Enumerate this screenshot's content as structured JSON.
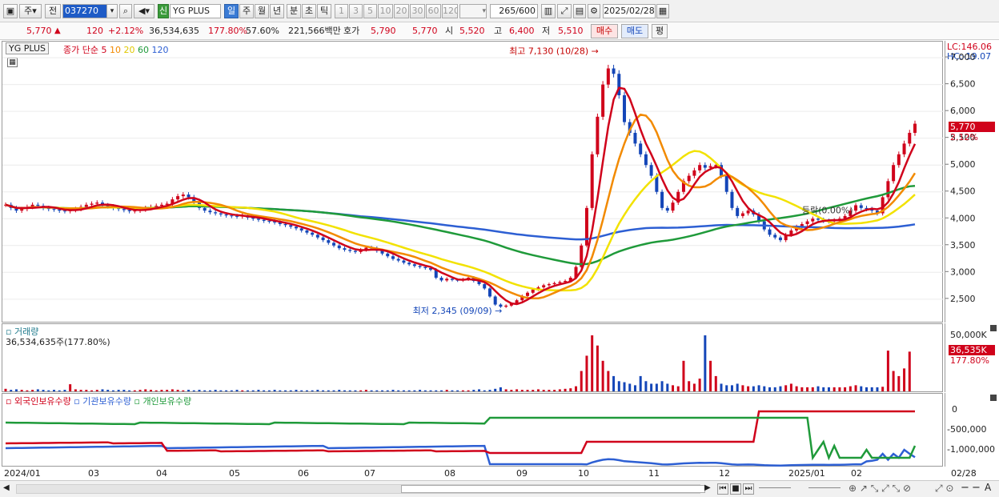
{
  "toolbar": {
    "period_type": "주",
    "prev_label": "전",
    "code": "037270",
    "name_tag": "신",
    "stock_name": "YG PLUS",
    "periods": [
      "일",
      "주",
      "월",
      "년",
      "분",
      "초",
      "틱"
    ],
    "selected_period": "일",
    "intervals": [
      "1",
      "3",
      "5",
      "10",
      "20",
      "30",
      "60",
      "120"
    ],
    "count": "265",
    "count_total": "/600",
    "date": "2025/02/28"
  },
  "quote": {
    "price": "5,770",
    "up_arrow": "▲",
    "change": "120",
    "change_pct": "+2.12%",
    "volume": "36,534,635",
    "volume_ratio": "177.80%",
    "turnover": "57.60%",
    "amount": "221,566백만",
    "ask_label": "호가",
    "ask": "5,790",
    "bid": "5,770",
    "open_label": "시",
    "open": "5,520",
    "high_label": "고",
    "high": "6,400",
    "low_label": "저",
    "low": "5,510",
    "buy_button": "매수",
    "sell_button": "매도",
    "eval_button": "평"
  },
  "chart_data": {
    "type": "candlestick",
    "stock": "YG PLUS",
    "close_label": "종가",
    "ma_label": "단순",
    "ma_periods": [
      "5",
      "10",
      "20",
      "60",
      "120"
    ],
    "ma_colors": [
      "#d0021b",
      "#f28a00",
      "#f2e200",
      "#1f9a3a",
      "#2d5fd3"
    ],
    "price_axis_ticks": [
      2500,
      3000,
      3500,
      4000,
      4500,
      5000,
      5500,
      6000,
      6500,
      7000
    ],
    "price_axis_labels": [
      "2,500",
      "3,000",
      "3,500",
      "4,000",
      "4,500",
      "5,000",
      "5,500",
      "6,000",
      "6,500",
      "7,000"
    ],
    "y_range": [
      2050,
      7300
    ],
    "lc": "LC:146.06",
    "hc": "HC:-19.07",
    "current_price": "5,770",
    "current_pct": "2.12%",
    "high_annotation": "최고 7,130 (10/28)",
    "low_annotation": "최저 2,345 (09/09)",
    "mid_annotation": "등락(0.00%)",
    "x_axis_labels": [
      "2024/01",
      "03",
      "04",
      "05",
      "06",
      "07",
      "08",
      "09",
      "10",
      "11",
      "12",
      "2025/01",
      "02",
      "02/28"
    ],
    "close_series": [
      4260,
      4200,
      4150,
      4180,
      4220,
      4260,
      4240,
      4200,
      4180,
      4170,
      4150,
      4140,
      4160,
      4180,
      4220,
      4260,
      4280,
      4300,
      4250,
      4230,
      4200,
      4180,
      4160,
      4140,
      4150,
      4170,
      4200,
      4220,
      4240,
      4260,
      4280,
      4360,
      4420,
      4450,
      4400,
      4300,
      4200,
      4150,
      4120,
      4100,
      4080,
      4060,
      4050,
      4040,
      4060,
      4020,
      4000,
      3980,
      3960,
      3950,
      3930,
      3900,
      3880,
      3850,
      3820,
      3780,
      3740,
      3700,
      3650,
      3600,
      3550,
      3500,
      3450,
      3420,
      3400,
      3380,
      3420,
      3460,
      3450,
      3400,
      3350,
      3300,
      3250,
      3220,
      3180,
      3150,
      3120,
      3100,
      3080,
      3050,
      2900,
      2850,
      2880,
      2860,
      2850,
      2870,
      2900,
      2840,
      2780,
      2700,
      2550,
      2400,
      2360,
      2380,
      2420,
      2480,
      2560,
      2620,
      2680,
      2720,
      2760,
      2780,
      2800,
      2820,
      2840,
      2900,
      3100,
      3500,
      4200,
      5200,
      5900,
      6500,
      6800,
      6700,
      6300,
      5800,
      5600,
      5400,
      5200,
      5000,
      4800,
      4500,
      4200,
      4150,
      4300,
      4500,
      4700,
      4800,
      4900,
      5000,
      4950,
      4980,
      5000,
      4800,
      4500,
      4200,
      4050,
      4100,
      4150,
      4080,
      3950,
      3800,
      3700,
      3650,
      3600,
      3700,
      3780,
      3850,
      3900,
      3950,
      4000,
      3980,
      3960,
      3950,
      3970,
      4000,
      4050,
      4150,
      4250,
      4200,
      4180,
      4150,
      4100,
      4400,
      4700,
      5000,
      5200,
      5400,
      5600,
      5770
    ],
    "volume_label": "거래량",
    "volume_value": "36,534,635주(177.80%)",
    "volume_axis_label": "50,000K",
    "volume_current": "36,535K",
    "volume_current_pct": "177.80%",
    "volume_values": [
      5,
      3,
      4,
      3,
      2,
      3,
      4,
      3,
      2,
      3,
      2,
      3,
      14,
      4,
      3,
      3,
      2,
      3,
      4,
      3,
      2,
      3,
      3,
      2,
      2,
      3,
      4,
      3,
      2,
      3,
      3,
      4,
      3,
      2,
      3,
      2,
      3,
      2,
      2,
      3,
      2,
      2,
      2,
      3,
      2,
      2,
      2,
      3,
      2,
      2,
      3,
      2,
      2,
      2,
      3,
      2,
      2,
      2,
      3,
      2,
      2,
      2,
      3,
      2,
      2,
      2,
      2,
      3,
      2,
      2,
      2,
      2,
      3,
      2,
      2,
      2,
      2,
      3,
      2,
      2,
      2,
      2,
      3,
      2,
      2,
      2,
      2,
      3,
      4,
      2,
      3,
      5,
      8,
      4,
      3,
      4,
      3,
      3,
      3,
      4,
      3,
      3,
      3,
      4,
      5,
      6,
      10,
      40,
      70,
      110,
      90,
      60,
      40,
      30,
      20,
      18,
      15,
      12,
      30,
      20,
      15,
      15,
      20,
      15,
      12,
      10,
      60,
      20,
      15,
      25,
      110,
      60,
      30,
      15,
      12,
      12,
      15,
      12,
      10,
      10,
      12,
      10,
      8,
      8,
      10,
      12,
      15,
      10,
      8,
      8,
      8,
      10,
      8,
      8,
      8,
      8,
      8,
      10,
      12,
      10,
      8,
      8,
      8,
      9,
      80,
      40,
      30,
      45,
      78
    ],
    "holdings_legend": [
      "외국인보유수량",
      "기관보유수량",
      "개인보유수량"
    ],
    "holdings_colors": [
      "#d0021b",
      "#2d5fd3",
      "#1f9a3a"
    ],
    "holdings_axis_labels": [
      "0",
      "-500,000",
      "-1,000,000"
    ]
  },
  "bottom": {
    "scroll_left": "◀",
    "nav_buttons": [
      "▶",
      "◀",
      "■",
      "▶"
    ],
    "zoom": "−"
  }
}
